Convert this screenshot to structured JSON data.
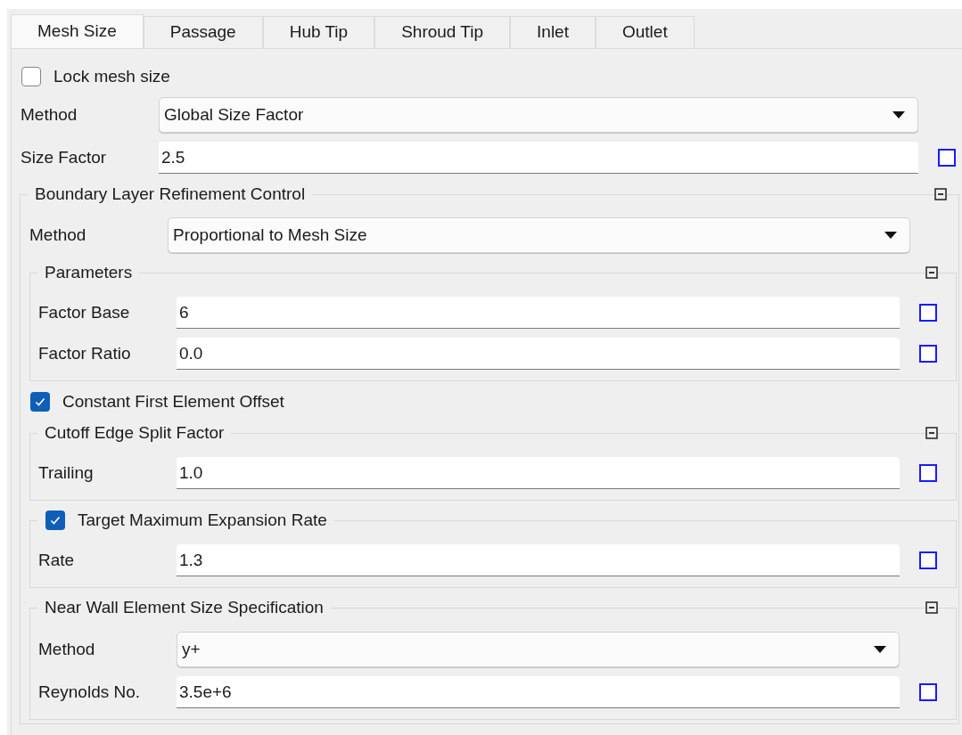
{
  "tabs": [
    {
      "label": "Mesh Size",
      "selected": true
    },
    {
      "label": "Passage",
      "selected": false
    },
    {
      "label": "Hub Tip",
      "selected": false
    },
    {
      "label": "Shroud Tip",
      "selected": false
    },
    {
      "label": "Inlet",
      "selected": false
    },
    {
      "label": "Outlet",
      "selected": false
    }
  ],
  "items": [
    {
      "kind": "checkbox",
      "label": "Lock mesh size",
      "checked": false
    },
    {
      "kind": "combo",
      "label": "Method",
      "value": "Global Size Factor"
    },
    {
      "kind": "field",
      "label": "Size Factor",
      "value": "2.5",
      "param_checked": false
    },
    {
      "kind": "group",
      "title": "Boundary Layer Refinement Control",
      "collapsible": true,
      "children": [
        {
          "kind": "combo",
          "label": "Method",
          "value": "Proportional to Mesh Size"
        },
        {
          "kind": "group",
          "title": "Parameters",
          "collapsible": true,
          "children": [
            {
              "kind": "field",
              "label": "Factor Base",
              "value": "6",
              "param_checked": false
            },
            {
              "kind": "field",
              "label": "Factor Ratio",
              "value": "0.0",
              "param_checked": false
            }
          ]
        },
        {
          "kind": "checkbox",
          "label": "Constant First Element Offset",
          "checked": true
        },
        {
          "kind": "group",
          "title": "Cutoff Edge Split Factor",
          "collapsible": true,
          "children": [
            {
              "kind": "field",
              "label": "Trailing",
              "value": "1.0",
              "param_checked": false
            }
          ]
        },
        {
          "kind": "group",
          "title": "Target Maximum Expansion Rate",
          "collapsible": false,
          "checked": true,
          "children": [
            {
              "kind": "field",
              "label": "Rate",
              "value": "1.3",
              "param_checked": false
            }
          ]
        },
        {
          "kind": "group",
          "title": "Near Wall Element Size Specification",
          "collapsible": true,
          "children": [
            {
              "kind": "combo",
              "label": "Method",
              "value": "y+"
            },
            {
              "kind": "field",
              "label": "Reynolds No.",
              "value": "3.5e+6",
              "param_checked": false
            }
          ]
        }
      ]
    }
  ]
}
